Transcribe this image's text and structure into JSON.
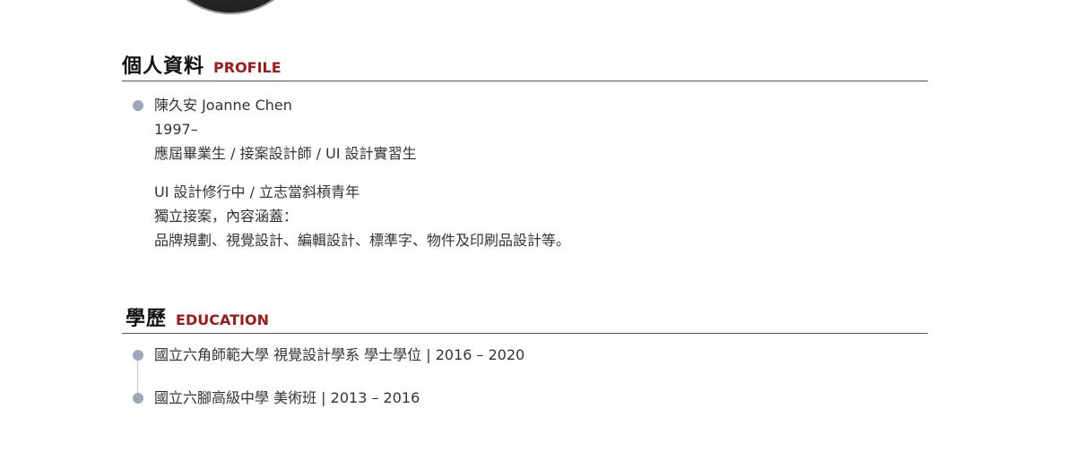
{
  "profile": {
    "title_zh": "個人資料",
    "title_en": "PROFILE",
    "lines_a": [
      "陳久安 Joanne Chen",
      "1997–",
      "應屆畢業生 / 接案設計師 / UI 設計實習生"
    ],
    "lines_b": [
      "UI 設計修行中 / 立志當斜槓青年",
      "獨立接案，內容涵蓋：",
      "品牌規劃、視覺設計、編輯設計、標準字、物件及印刷品設計等。"
    ]
  },
  "education": {
    "title_zh": "學歷",
    "title_en": "EDUCATION",
    "items": [
      "國立六角師範大學 視覺設計學系 學士學位 | 2016 – 2020",
      "國立六腳高級中學 美術班 | 2013 – 2016"
    ]
  },
  "colors": {
    "accent": "#a01a1a",
    "bullet": "#9aa7bd",
    "divider": "#555555"
  }
}
